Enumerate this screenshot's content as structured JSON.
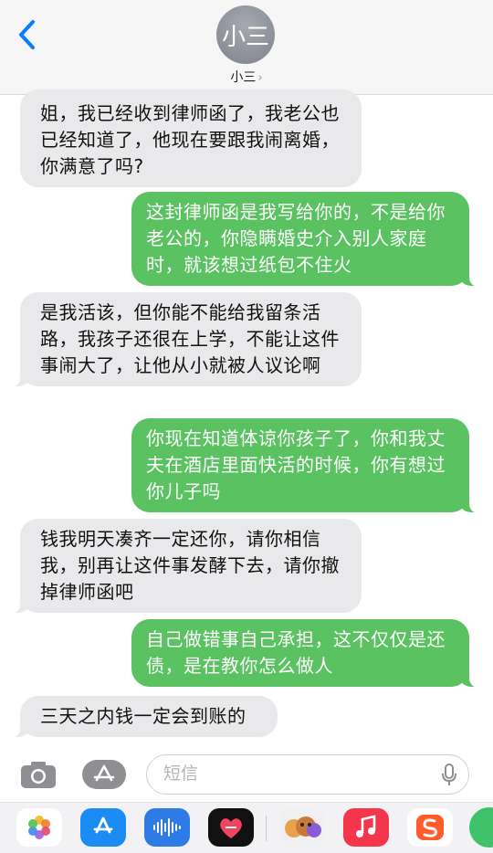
{
  "header": {
    "contact_avatar_text": "小三",
    "contact_name": "小三"
  },
  "messages": [
    {
      "side": "in",
      "text": "姐，我已经收到律师函了，我老公也已经知道了，他现在要跟我闹离婚，你满意了吗?"
    },
    {
      "side": "out",
      "text": "这封律师函是我写给你的，不是给你老公的，你隐瞒婚史介入别人家庭时，就该想过纸包不住火"
    },
    {
      "side": "in",
      "text": "是我活该，但你能不能给我留条活路，我孩子还很在上学，不能让这件事闹大了，让他从小就被人议论啊"
    },
    {
      "side": "out",
      "text": "你现在知道体谅你孩子了，你和我丈夫在酒店里面快活的时候，你有想过你儿子吗"
    },
    {
      "side": "in",
      "text": "钱我明天凑齐一定还你，请你相信我，别再让这件事发酵下去，请你撤掉律师函吧"
    },
    {
      "side": "out",
      "text": "自己做错事自己承担，这不仅仅是还债，是在教你怎么做人"
    },
    {
      "side": "in",
      "text": "三天之内钱一定会到账的"
    }
  ],
  "input": {
    "placeholder": "短信"
  },
  "app_drawer": [
    {
      "name": "photos-app-icon",
      "color": "#ffffff"
    },
    {
      "name": "app-store-app-icon",
      "color": "#1a8cf4"
    },
    {
      "name": "audio-app-icon",
      "color": "#2f7be6"
    },
    {
      "name": "digital-touch-app-icon",
      "color": "#111111"
    },
    {
      "name": "memoji-app-icon",
      "color": "#f0f0f0"
    },
    {
      "name": "music-app-icon",
      "color": "#f4364c"
    },
    {
      "name": "sogou-app-icon",
      "color": "#ffffff"
    },
    {
      "name": "more-app-icon",
      "color": "#3fc26a"
    }
  ],
  "colors": {
    "accent": "#0a7cff",
    "outgoing_bubble": "#5ac261",
    "incoming_bubble": "#e9e9eb"
  }
}
